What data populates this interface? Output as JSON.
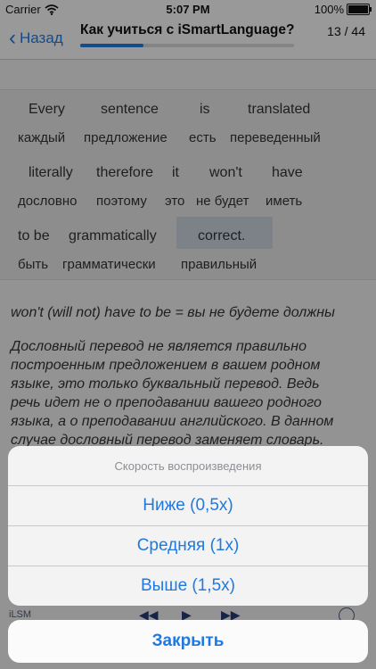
{
  "status_bar": {
    "carrier": "Carrier",
    "time": "5:07 PM",
    "battery_percent": "100%",
    "wifi_icon": "wifi-icon",
    "battery_icon": "battery-icon"
  },
  "nav": {
    "back_label": "Назад",
    "back_icon": "chevron-left-icon",
    "title": "Как учиться с iSmartLanguage?",
    "counter": "13 / 44",
    "progress": 0.295
  },
  "sentence": {
    "lines": [
      {
        "english": [
          "Every",
          "sentence",
          "is",
          "translated"
        ],
        "russian": [
          "каждый",
          "предложение",
          "есть",
          "переведенный"
        ]
      },
      {
        "english": [
          "literally",
          "therefore",
          "it",
          "won't",
          "have"
        ],
        "russian": [
          "дословно",
          "поэтому",
          "это",
          "не будет",
          "иметь"
        ]
      },
      {
        "english": [
          "to be",
          "grammatically",
          "correct."
        ],
        "russian": [
          "быть",
          "грамматически",
          "правильный"
        ],
        "highlighted": "correct."
      }
    ]
  },
  "explanation": {
    "note": "won't (will not) have to be = вы не будете должны",
    "paragraph_lines": [
      "Дословный перевод не является правильно",
      "построенным предложением в вашем родном",
      "языке, это только буквальный перевод. Ведь",
      "речь идет не о преподавании вашего родного",
      "языка, а о преподавании английского. В данном",
      "случае дословный перевод заменяет словарь."
    ]
  },
  "toolbar": {
    "left_label": "iLSM",
    "prev_icon": "rewind-icon",
    "play_icon": "play-icon",
    "next_icon": "fast-forward-icon",
    "timer_icon": "timer-icon"
  },
  "action_sheet": {
    "title": "Скорость воспроизведения",
    "options": [
      "Ниже (0,5x)",
      "Средняя (1x)",
      "Выше (1,5x)"
    ],
    "cancel": "Закрыть"
  },
  "colors": {
    "accent": "#1f79e0",
    "sentence_background": "#e4e4e6",
    "highlight": "#c8d2dc"
  }
}
